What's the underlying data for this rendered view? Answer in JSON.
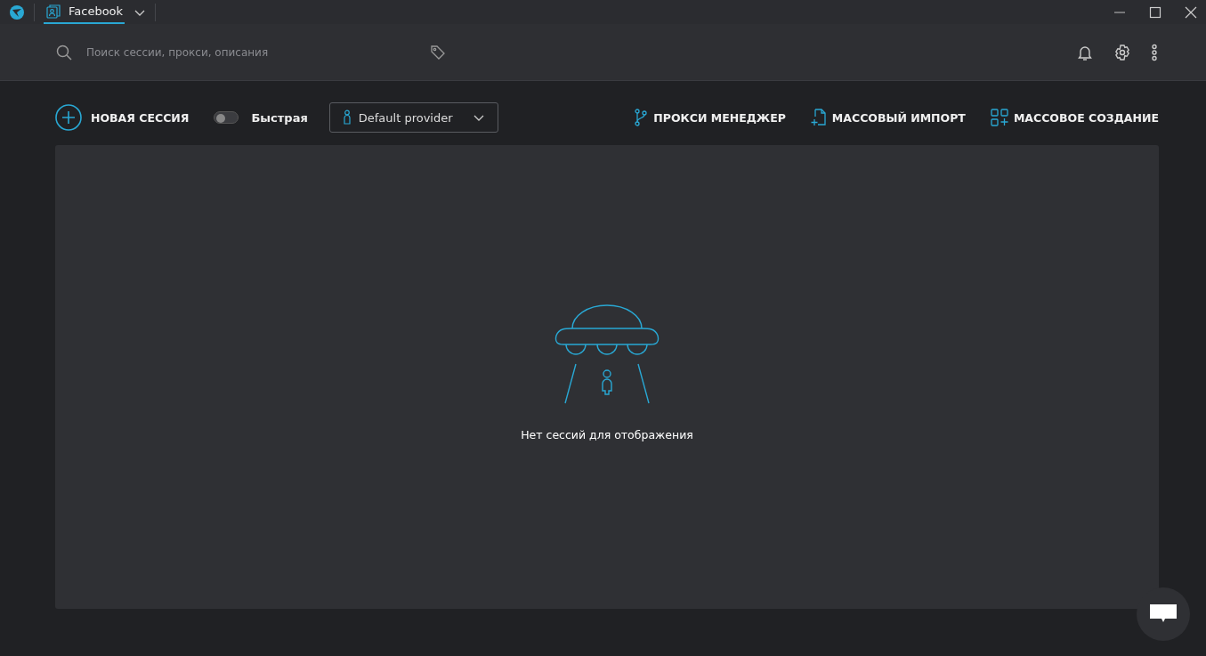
{
  "tabs": [
    {
      "label": "Facebook",
      "selected": true
    }
  ],
  "search": {
    "placeholder": "Поиск сессии, прокси, описания"
  },
  "toolbar": {
    "new_session": "НОВАЯ СЕССИЯ",
    "quick": {
      "label": "Быстрая",
      "on": false
    },
    "provider": {
      "value": "Default provider"
    },
    "actions": [
      {
        "kind": "proxy",
        "label": "ПРОКСИ МЕНЕДЖЕР"
      },
      {
        "kind": "import",
        "label": "МАССОВЫЙ ИМПОРТ"
      },
      {
        "kind": "create",
        "label": "МАССОВОЕ СОЗДАНИЕ"
      }
    ]
  },
  "empty": {
    "message": "Нет сессий для отображения"
  }
}
